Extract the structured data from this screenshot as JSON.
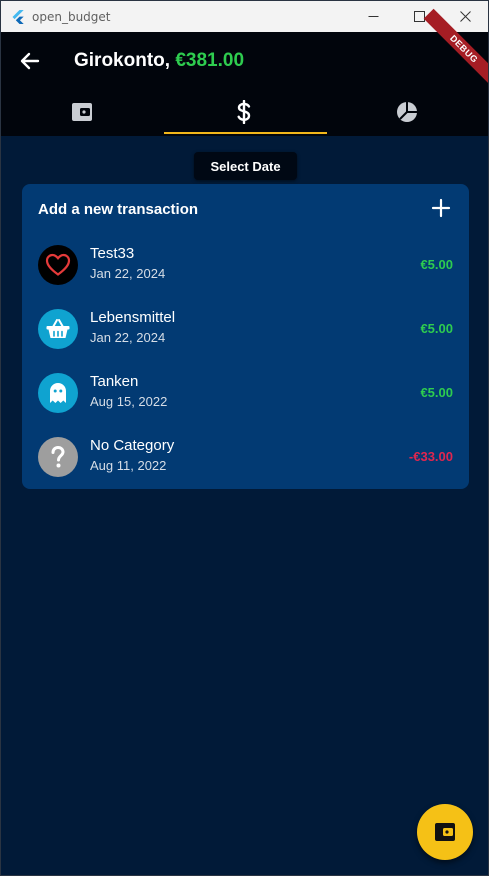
{
  "window": {
    "title": "open_budget"
  },
  "appbar": {
    "account_name": "Girokonto,",
    "balance": "€381.00",
    "debug_banner": "DEBUG"
  },
  "tabs": [
    {
      "icon": "wallet-icon",
      "selected": false
    },
    {
      "icon": "dollar-icon",
      "selected": true
    },
    {
      "icon": "pie-chart-icon",
      "selected": false
    }
  ],
  "select_date_label": "Select Date",
  "card": {
    "header": "Add a new transaction",
    "transactions": [
      {
        "name": "Test33",
        "date": "Jan 22, 2024",
        "amount": "€5.00",
        "icon": "heart-icon",
        "amount_color": "#2ecc4f",
        "icon_bg": "#000000"
      },
      {
        "name": "Lebensmittel",
        "date": "Jan 22, 2024",
        "amount": "€5.00",
        "icon": "basket-icon",
        "amount_color": "#2ecc4f",
        "icon_bg": "#0fa3d0"
      },
      {
        "name": "Tanken",
        "date": "Aug 15, 2022",
        "amount": "€5.00",
        "icon": "ghost-icon",
        "amount_color": "#2ecc4f",
        "icon_bg": "#0fa3d0"
      },
      {
        "name": "No Category",
        "date": "Aug 11, 2022",
        "amount": "-€33.00",
        "icon": "question-icon",
        "amount_color": "#e0264f",
        "icon_bg": "#9e9e9e"
      }
    ]
  },
  "colors": {
    "accent": "#f2b71a",
    "positive": "#2ecc4f",
    "negative": "#e0264f",
    "card": "#023a73",
    "background": "#011a38"
  }
}
